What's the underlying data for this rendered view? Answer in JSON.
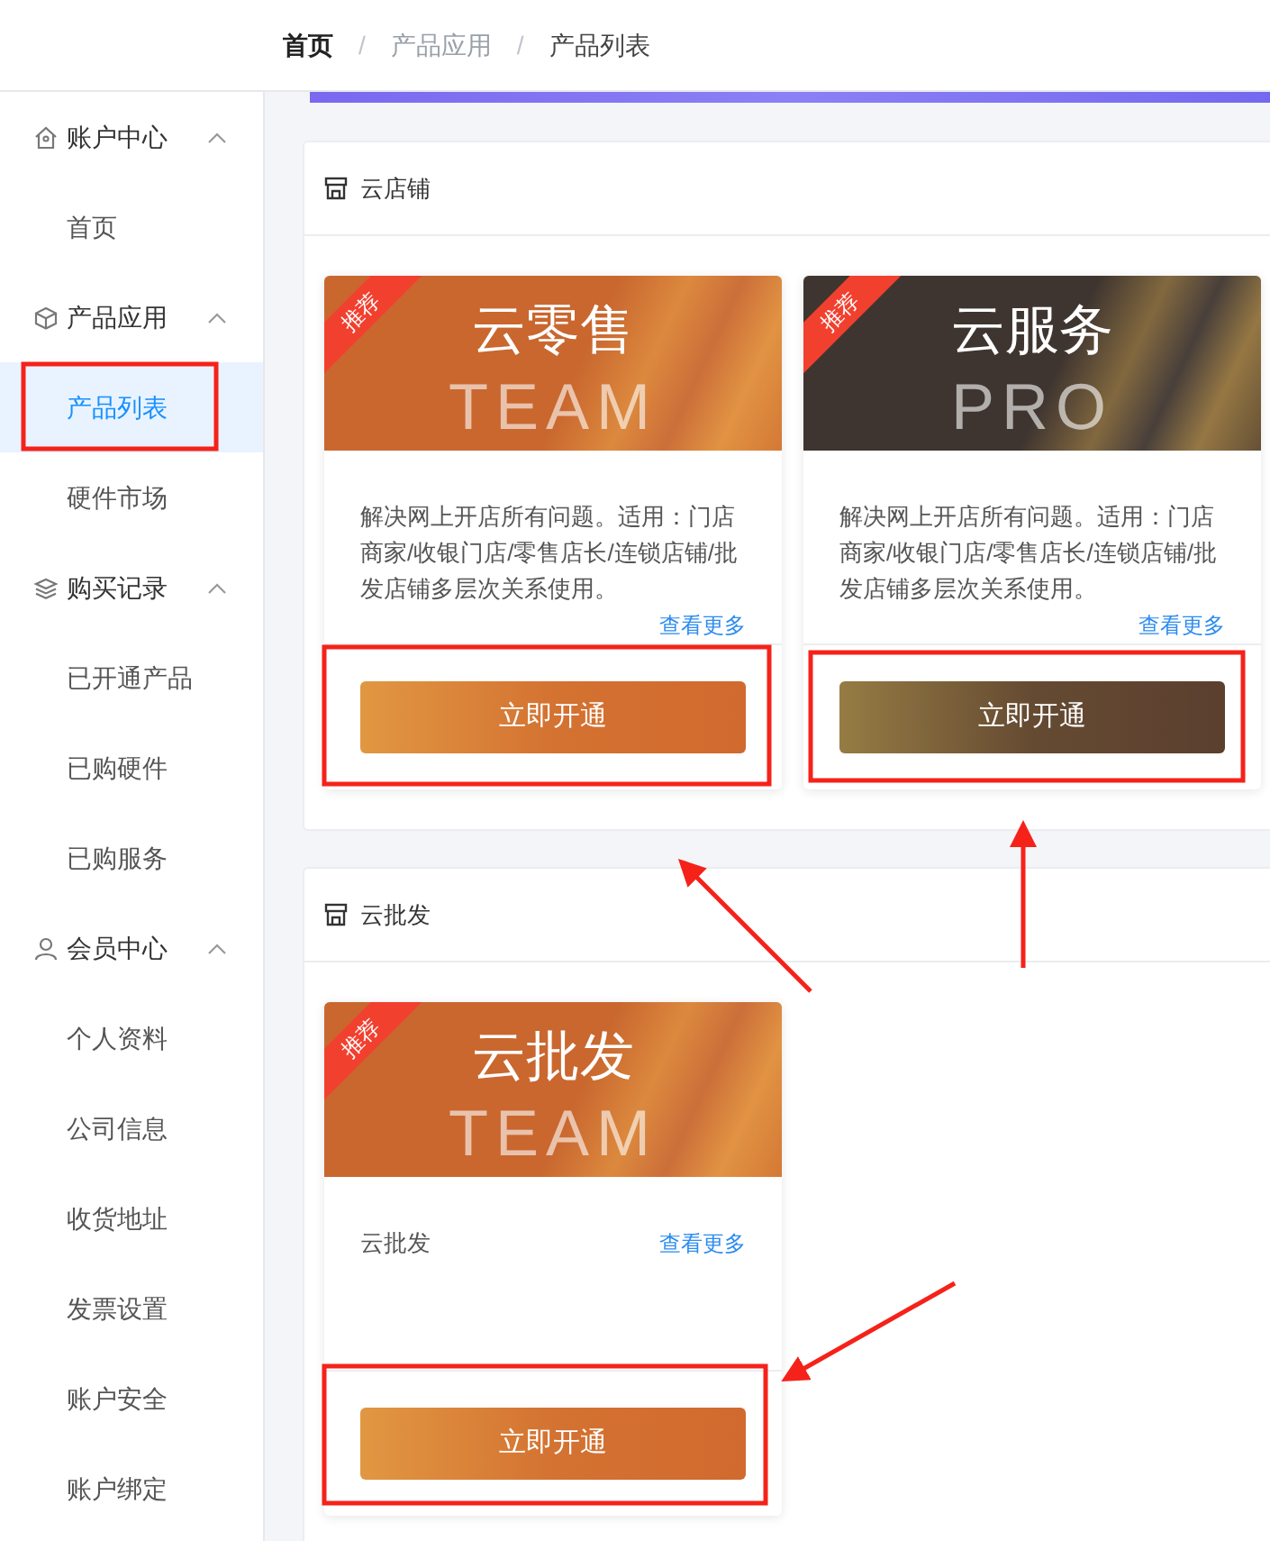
{
  "breadcrumb": [
    {
      "label": "首页",
      "kind": "home"
    },
    {
      "label": "/",
      "kind": "separator"
    },
    {
      "label": "产品应用",
      "kind": "link"
    },
    {
      "label": "/",
      "kind": "separator"
    },
    {
      "label": "产品列表",
      "kind": "current"
    }
  ],
  "sidebar": {
    "groups": [
      {
        "label": "账户中心",
        "expanded": true,
        "children": [
          {
            "label": "首页",
            "selected": false
          }
        ]
      },
      {
        "label": "产品应用",
        "expanded": true,
        "children": [
          {
            "label": "产品列表",
            "selected": true
          },
          {
            "label": "硬件市场",
            "selected": false
          }
        ]
      },
      {
        "label": "购买记录",
        "expanded": true,
        "children": [
          {
            "label": "已开通产品",
            "selected": false
          },
          {
            "label": "已购硬件",
            "selected": false
          },
          {
            "label": "已购服务",
            "selected": false
          }
        ]
      },
      {
        "label": "会员中心",
        "expanded": true,
        "children": [
          {
            "label": "个人资料",
            "selected": false
          },
          {
            "label": "公司信息",
            "selected": false
          },
          {
            "label": "收货地址",
            "selected": false
          },
          {
            "label": "发票设置",
            "selected": false
          },
          {
            "label": "账户安全",
            "selected": false
          },
          {
            "label": "账户绑定",
            "selected": false
          }
        ]
      }
    ]
  },
  "sections": [
    {
      "title": "云店铺",
      "cards": [
        {
          "title": "云零售",
          "watermark": "TEAM",
          "color": "#c9672f",
          "ribbon": "推荐",
          "description": "解决网上开店所有问题。适用：门店商家/收银门店/零售店长/连锁店铺/批发店铺多层次关系使用。",
          "more_link": "查看更多",
          "button": "立即开通"
        },
        {
          "title": "云服务",
          "watermark": "PRO",
          "color": "#3f3530",
          "ribbon": "推荐",
          "description": "解决网上开店所有问题。适用：门店商家/收银门店/零售店长/连锁店铺/批发店铺多层次关系使用。",
          "more_link": "查看更多",
          "button": "立即开通"
        }
      ]
    },
    {
      "title": "云批发",
      "cards": [
        {
          "title": "云批发",
          "watermark": "TEAM",
          "color": "#c9672f",
          "ribbon": "推荐",
          "description": "云批发",
          "more_link": "查看更多",
          "button": "立即开通"
        }
      ]
    }
  ]
}
